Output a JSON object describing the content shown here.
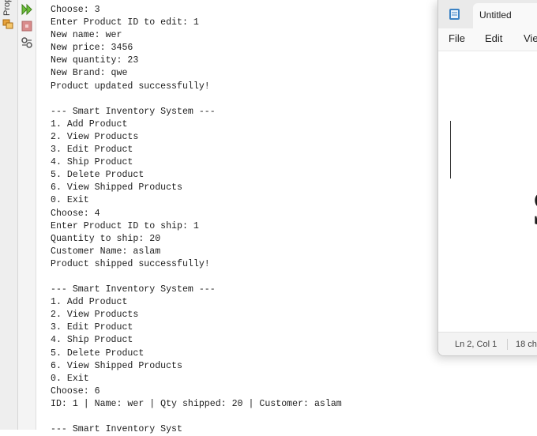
{
  "sidebar": {
    "label": "Prop"
  },
  "toolbar": {
    "run_icon": "rerun-icon",
    "stop_icon": "stop-icon",
    "settings_icon": "settings-icon"
  },
  "console": {
    "lines": [
      "Choose: 3",
      "Enter Product ID to edit: 1",
      "New name: wer",
      "New price: 3456",
      "New quantity: 23",
      "New Brand: qwe",
      "Product updated successfully!",
      "",
      "--- Smart Inventory System ---",
      "1. Add Product",
      "2. View Products",
      "3. Edit Product",
      "4. Ship Product",
      "5. Delete Product",
      "6. View Shipped Products",
      "0. Exit",
      "Choose: 4",
      "Enter Product ID to ship: 1",
      "Quantity to ship: 20",
      "Customer Name: aslam",
      "Product shipped successfully!",
      "",
      "--- Smart Inventory System ---",
      "1. Add Product",
      "2. View Products",
      "3. Edit Product",
      "4. Ship Product",
      "5. Delete Product",
      "6. View Shipped Products",
      "0. Exit",
      "Choose: 6",
      "ID: 1 | Name: wer | Qty shipped: 20 | Customer: aslam",
      "",
      "--- Smart Inventory Syst"
    ]
  },
  "notepad": {
    "title": "Untitled",
    "menu": {
      "file": "File",
      "edit": "Edit",
      "view": "Vie"
    },
    "big_char": "S",
    "status": {
      "position": "Ln 2, Col 1",
      "chars": "18 ch"
    }
  }
}
